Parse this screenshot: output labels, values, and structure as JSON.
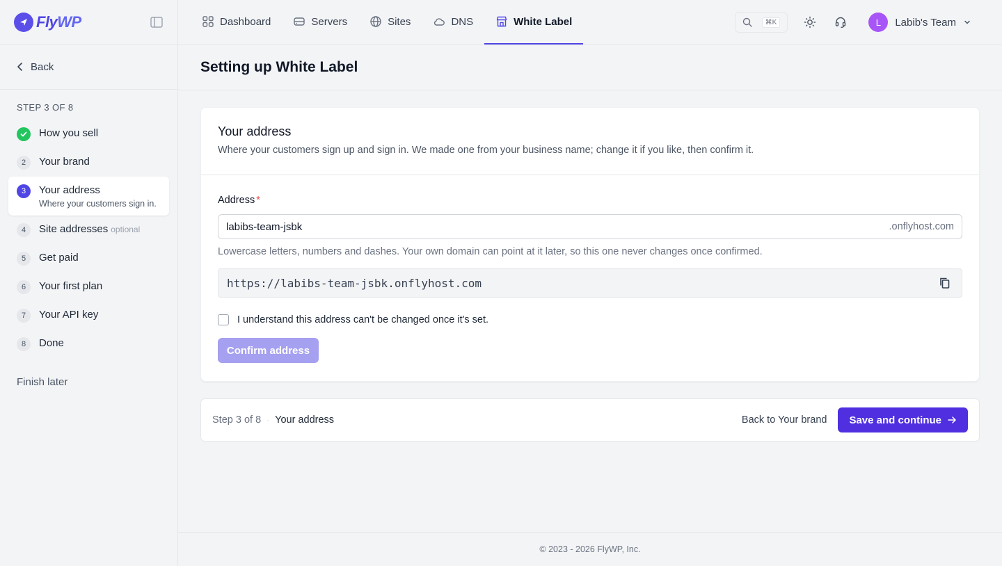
{
  "brand": {
    "name_part1": "Fly",
    "name_part2": "WP"
  },
  "colors": {
    "accent": "#4f46e5",
    "primary_button": "#4f2fe0",
    "disabled_button": "#a5a0f0",
    "success": "#22c55e",
    "avatar": "#a855f7"
  },
  "sidebar": {
    "back_label": "Back",
    "step_counter": "STEP 3 OF 8",
    "steps": [
      {
        "num": "1",
        "title": "How you sell",
        "status": "done"
      },
      {
        "num": "2",
        "title": "Your brand",
        "status": "pending"
      },
      {
        "num": "3",
        "title": "Your address",
        "subtitle": "Where your customers sign in.",
        "status": "active"
      },
      {
        "num": "4",
        "title": "Site addresses",
        "tag": "optional",
        "status": "pending"
      },
      {
        "num": "5",
        "title": "Get paid",
        "status": "pending"
      },
      {
        "num": "6",
        "title": "Your first plan",
        "status": "pending"
      },
      {
        "num": "7",
        "title": "Your API key",
        "status": "pending"
      },
      {
        "num": "8",
        "title": "Done",
        "status": "pending"
      }
    ],
    "finish_later": "Finish later"
  },
  "nav": {
    "items": [
      {
        "label": "Dashboard",
        "icon": "grid-icon"
      },
      {
        "label": "Servers",
        "icon": "server-icon"
      },
      {
        "label": "Sites",
        "icon": "globe-icon"
      },
      {
        "label": "DNS",
        "icon": "cloud-icon"
      },
      {
        "label": "White Label",
        "icon": "store-icon",
        "active": true
      }
    ],
    "search_shortcut": "⌘K",
    "team_initial": "L",
    "team_name": "Labib's Team"
  },
  "page": {
    "title": "Setting up White Label"
  },
  "card": {
    "title": "Your address",
    "description": "Where your customers sign up and sign in. We made one from your business name; change it if you like, then confirm it.",
    "field_label": "Address",
    "required_mark": "*",
    "address_value": "labibs-team-jsbk",
    "address_suffix": ".onflyhost.com",
    "help_text": "Lowercase letters, numbers and dashes. Your own domain can point at it later, so this one never changes once confirmed.",
    "full_url": "https://labibs-team-jsbk.onflyhost.com",
    "checkbox_label": "I understand this address can't be changed once it's set.",
    "confirm_label": "Confirm address"
  },
  "footer_bar": {
    "step_text": "Step 3 of 8",
    "separator": "·",
    "step_name": "Your address",
    "back_label": "Back to Your brand",
    "save_label": "Save and continue"
  },
  "copyright": "© 2023 - 2026 FlyWP, Inc."
}
